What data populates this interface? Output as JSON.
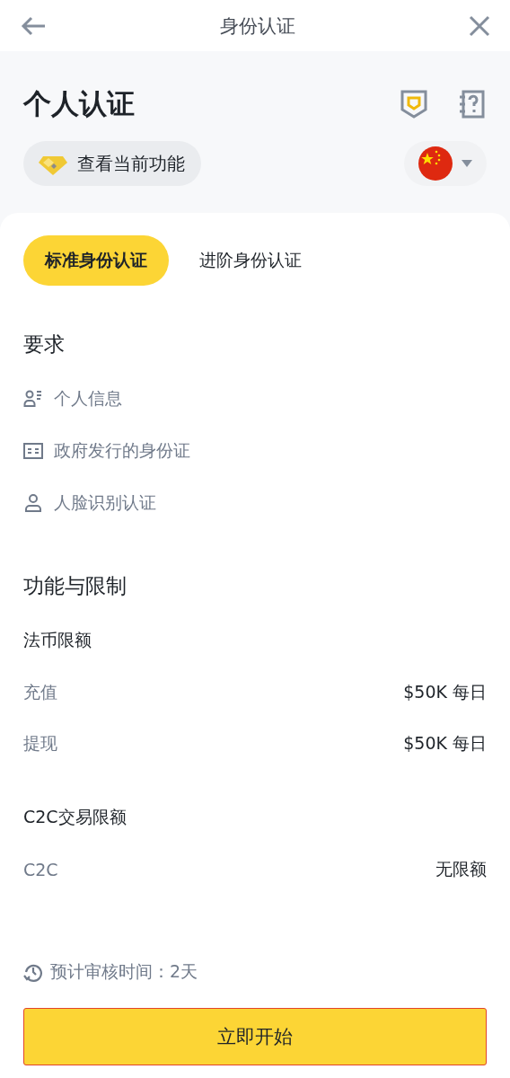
{
  "header": {
    "title": "身份认证"
  },
  "page": {
    "title": "个人认证",
    "features_button": "查看当前功能"
  },
  "tabs": [
    {
      "label": "标准身份认证",
      "selected": true
    },
    {
      "label": "进阶身份认证",
      "selected": false
    }
  ],
  "requirements": {
    "heading": "要求",
    "items": [
      {
        "kind": "profile",
        "label": "个人信息"
      },
      {
        "kind": "id-card",
        "label": "政府发行的身份证"
      },
      {
        "kind": "person",
        "label": "人脸识别认证"
      }
    ]
  },
  "limits": {
    "heading": "功能与限制",
    "groups": [
      {
        "title": "法币限额",
        "rows": [
          {
            "label": "充值",
            "value": "$50K 每日"
          },
          {
            "label": "提现",
            "value": "$50K 每日"
          }
        ]
      },
      {
        "title": "C2C交易限额",
        "rows": [
          {
            "label": "C2C",
            "value": "无限额"
          }
        ]
      }
    ]
  },
  "footer": {
    "review_time": "预计审核时间：2天",
    "start_button": "立即开始"
  }
}
